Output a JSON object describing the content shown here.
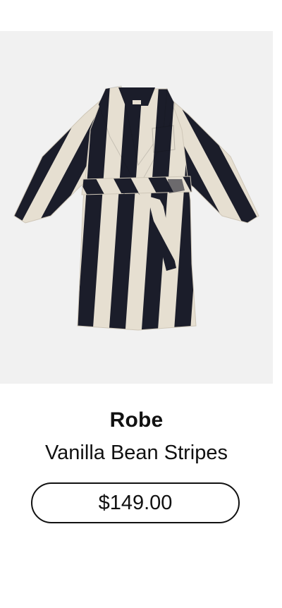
{
  "product": {
    "image_label": "robe-product-image",
    "title": "Robe",
    "variant": "Vanilla Bean Stripes",
    "price": "$149.00"
  },
  "colors": {
    "image_background": "#f1f1f1",
    "stripe_dark": "#1b1d2a",
    "stripe_light": "#e6dfd1",
    "text": "#111111",
    "button_border": "#111111"
  }
}
